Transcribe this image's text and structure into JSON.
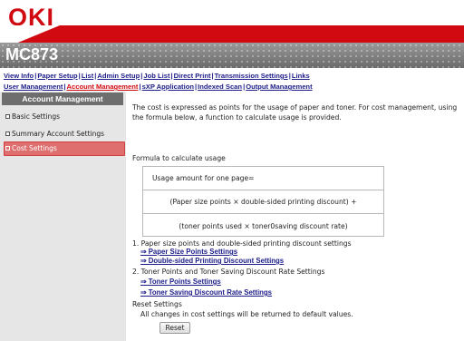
{
  "header": {
    "brand": "OKI",
    "model": "MC873"
  },
  "nav": {
    "row1": [
      "View Info",
      "Paper Setup",
      "List",
      "Admin Setup",
      "Job List",
      "Direct Print",
      "Transmission Settings",
      "Links"
    ],
    "row2": [
      "User Management",
      "Account Management",
      "sXP Application",
      "Indexed Scan",
      "Output Management"
    ],
    "active": "Account Management"
  },
  "sidebar": {
    "title": "Account Management",
    "items": [
      {
        "label": "Basic Settings"
      },
      {
        "label": "Summary Account Settings"
      },
      {
        "label": "Cost Settings",
        "selected": true
      }
    ]
  },
  "main": {
    "intro": "The cost is expressed as points for the usage of paper and toner. For cost management, using the formula below, a function to calculate usage is provided.",
    "formula_title": "Formula to calculate usage",
    "formula": {
      "line1": "Usage amount for one page=",
      "line2": "(Paper size points × double-sided printing discount) +",
      "line3": "(toner points used × toner0saving discount rate)"
    },
    "section1": "1. Paper size points and double-sided printing discount settings",
    "link1": "⇒ Paper Size Points Settings",
    "link2": "⇒ Double-sided Printing Discount Settings",
    "section2": "2. Toner Points and Toner Saving Discount Rate Settings",
    "link3": "⇒ Toner Points Settings",
    "link4": "⇒ Toner Saving Discount Rate Settings",
    "reset_title": "Reset Settings",
    "reset_desc": "All changes in cost settings will be returned to default values.",
    "reset_button": "Reset"
  },
  "colors": {
    "brand_red": "#d10a11",
    "link_blue": "#1c1c8a",
    "selected_bg": "#df6f6f"
  }
}
